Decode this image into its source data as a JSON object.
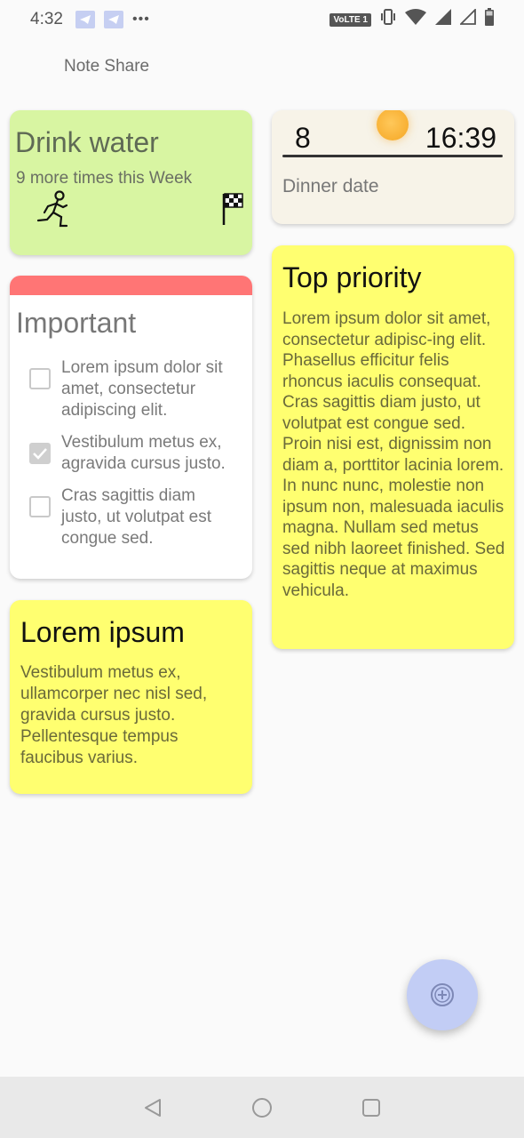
{
  "status_bar": {
    "time": "4:32",
    "network_badge": "VoLTE 1",
    "icons": [
      "telegram-icon",
      "telegram-icon",
      "more-icon",
      "vibrate-icon",
      "wifi-icon",
      "signal-icon",
      "signal-icon",
      "battery-icon"
    ]
  },
  "header": {
    "title": "Note Share"
  },
  "notes": {
    "drink_water": {
      "title": "Drink water",
      "subtitle": "9 more times this Week",
      "color": "#d8f5a2"
    },
    "dinner": {
      "day": "8",
      "time": "16:39",
      "label": "Dinner date",
      "color": "#f7f3e8"
    },
    "important": {
      "title": "Important",
      "accent": "#ff7575",
      "items": [
        {
          "text": "Lorem ipsum dolor sit amet, consectetur adipiscing elit.",
          "checked": false
        },
        {
          "text": "Vestibulum metus ex, agravida cursus justo.",
          "checked": true
        },
        {
          "text": "Cras sagittis diam justo, ut volutpat est congue sed.",
          "checked": false
        }
      ]
    },
    "top_priority": {
      "title": "Top priority",
      "body": "Lorem ipsum dolor sit amet, consectetur adipisc-ing elit. Phasellus efficitur felis rhoncus iaculis consequat. Cras sagittis diam justo, ut volutpat est congue sed. Proin nisi est, dignissim non diam a, porttitor lacinia lorem. In nunc nunc, molestie non ipsum non, malesuada iaculis magna. Nullam sed metus sed nibh laoreet finished. Sed sagittis neque at maximus vehicula.",
      "color": "#ffff70"
    },
    "lorem": {
      "title": "Lorem ipsum",
      "body": "Vestibulum metus ex, ullamcorper nec nisl sed, gravida cursus justo. Pellentesque tempus faucibus varius.",
      "color": "#ffff70"
    }
  },
  "fab": {
    "icon": "add-icon"
  },
  "nav": {
    "icons": [
      "back-icon",
      "home-icon",
      "recents-icon"
    ]
  }
}
